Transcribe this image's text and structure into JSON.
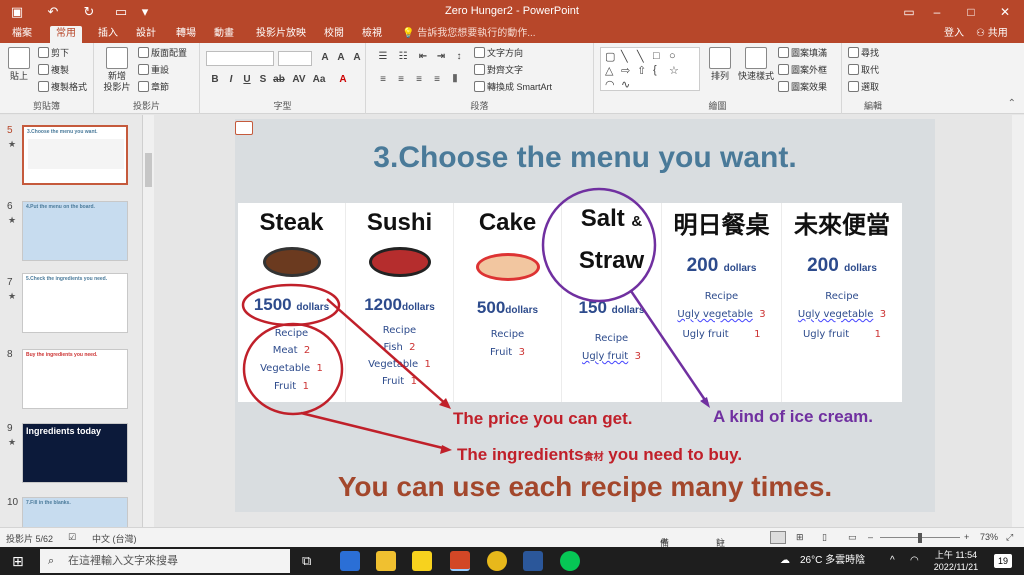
{
  "window": {
    "title": "Zero Hunger2 - PowerPoint",
    "minimize_icon": "minimize-icon",
    "maximize_icon": "maximize-icon",
    "close_icon": "close-icon"
  },
  "tabs": [
    {
      "label": "檔案"
    },
    {
      "label": "常用"
    },
    {
      "label": "插入"
    },
    {
      "label": "設計"
    },
    {
      "label": "轉場"
    },
    {
      "label": "動畫"
    },
    {
      "label": "投影片放映"
    },
    {
      "label": "校閱"
    },
    {
      "label": "檢視"
    }
  ],
  "tell_me": "告訴我您想要執行的動作...",
  "account": {
    "login": "登入",
    "share": "共用"
  },
  "ribbon": {
    "clipboard": {
      "label": "剪貼簿",
      "paste": "貼上",
      "cut": "剪下",
      "copy": "複製",
      "format_painter": "複製格式"
    },
    "slides": {
      "label": "投影片",
      "new_slide": "新增",
      "new_slide2": "投影片",
      "layout": "版面配置",
      "reset": "重設",
      "section": "章節"
    },
    "font": {
      "label": "字型"
    },
    "paragraph": {
      "label": "段落",
      "text_direction": "文字方向",
      "align_text": "對齊文字",
      "smartart": "轉換成 SmartArt"
    },
    "drawing": {
      "label": "繪圖",
      "arrange": "排列",
      "quick_styles": "快速樣式",
      "shape_fill": "圖案填滿",
      "shape_outline": "圖案外框",
      "shape_effects": "圖案效果"
    },
    "editing": {
      "label": "編輯",
      "find": "尋找",
      "replace": "取代",
      "select": "選取"
    }
  },
  "thumbnails": [
    {
      "num": "5",
      "title": "3.Choose the menu you want."
    },
    {
      "num": "6",
      "title": "4.Put the menu on the board."
    },
    {
      "num": "7",
      "title": "5.Check the ingredients you need."
    },
    {
      "num": "8",
      "title": "Buy the ingredients you need."
    },
    {
      "num": "9",
      "title": "Ingredients today"
    },
    {
      "num": "10",
      "title": "7.Fill in the blanks."
    }
  ],
  "slide": {
    "title": "3.Choose the menu you want.",
    "columns": [
      {
        "head": "Steak",
        "price": "1500",
        "unit": "dollars",
        "recipe": "Recipe",
        "items": [
          "Meat",
          "Vegetable",
          "Fruit"
        ],
        "qty": [
          "2",
          "1",
          "1"
        ]
      },
      {
        "head": "Sushi",
        "price": "1200",
        "unit": "dollars",
        "recipe": "Recipe",
        "items": [
          "Fish",
          "Vegetable",
          "Fruit"
        ],
        "qty": [
          "2",
          "1",
          "1"
        ]
      },
      {
        "head": "Cake",
        "price": "500",
        "unit": "dollars",
        "recipe": "Recipe",
        "items": [
          "Fruit"
        ],
        "qty": [
          "3"
        ]
      },
      {
        "head": "Salt",
        "head_amp": "&",
        "head2": "Straw",
        "price": "150",
        "unit": "dollars",
        "recipe": "Recipe",
        "items": [
          "Ugly fruit"
        ],
        "qty": [
          "3"
        ]
      },
      {
        "head": "明日餐桌",
        "price": "200",
        "unit": "dollars",
        "recipe": "Recipe",
        "items": [
          "Ugly vegetable",
          "Ugly fruit"
        ],
        "qty": [
          "3",
          "1"
        ]
      },
      {
        "head": "未來便當",
        "price": "200",
        "unit": "dollars",
        "recipe": "Recipe",
        "items": [
          "Ugly vegetable",
          "Ugly fruit"
        ],
        "qty": [
          "3",
          "1"
        ]
      }
    ],
    "annotations": {
      "price": "The price you can get.",
      "ice_cream": "A kind of ice cream.",
      "ingredients_a": "The ingredients",
      "ingredients_small": "食材",
      "ingredients_b": " you need to buy."
    },
    "footer": "You can use each recipe many times."
  },
  "status": {
    "slide_count": "投影片 5/62",
    "language": "中文 (台灣)",
    "notes": "備忘稿",
    "comments": "註解",
    "zoom": "73%"
  },
  "taskbar": {
    "search_placeholder": "在這裡輸入文字來搜尋",
    "weather": "26°C 多雲時陰",
    "time": "上午 11:54",
    "date": "2022/11/21",
    "notifications": "19"
  },
  "colors": {
    "accent": "#b7472a",
    "title_blue": "#4a7a99",
    "footer_brown": "#a3472c",
    "annotation_red": "#c0202a",
    "annotation_purple": "#7030a0"
  }
}
